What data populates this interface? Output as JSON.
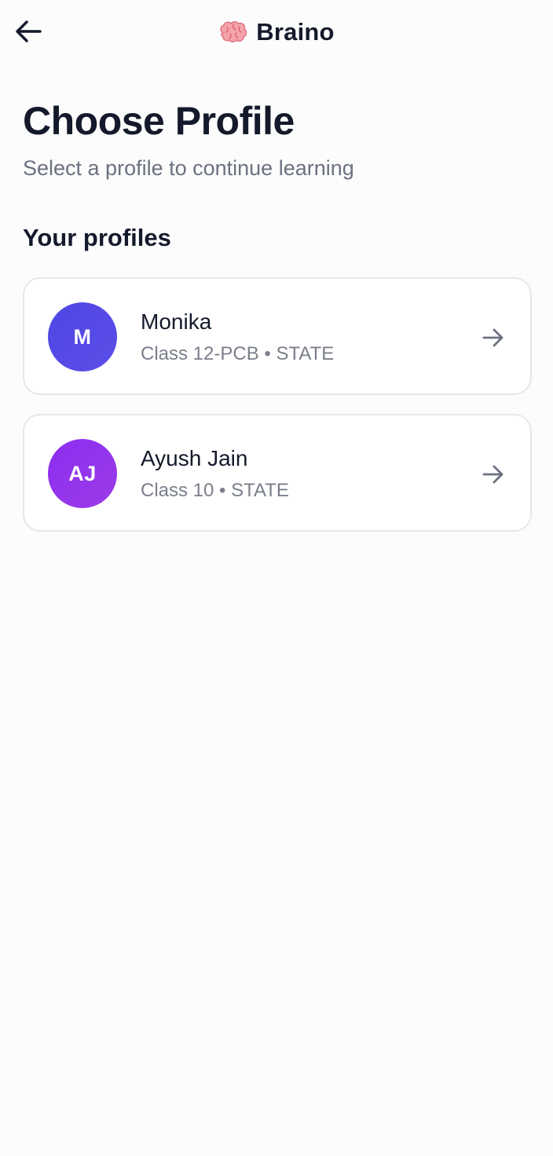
{
  "header": {
    "back_icon": "arrow-left-icon",
    "brand_icon": "brain-icon",
    "brand_name": "Braino"
  },
  "page": {
    "title": "Choose Profile",
    "subtitle": "Select a profile to continue learning"
  },
  "profiles_section": {
    "title": "Your profiles",
    "profiles": [
      {
        "initials": "M",
        "name": "Monika",
        "meta": "Class 12-PCB • STATE",
        "avatar_color": "#4f46e5",
        "action_icon": "arrow-right-icon"
      },
      {
        "initials": "AJ",
        "name": "Ayush Jain",
        "meta": "Class 10 • STATE",
        "avatar_color": "#9333ea",
        "action_icon": "arrow-right-icon"
      }
    ]
  },
  "colors": {
    "background": "#fcfcfc",
    "text_primary": "#141a2b",
    "text_secondary": "#6b7180",
    "card_border": "#e6e7ea"
  }
}
